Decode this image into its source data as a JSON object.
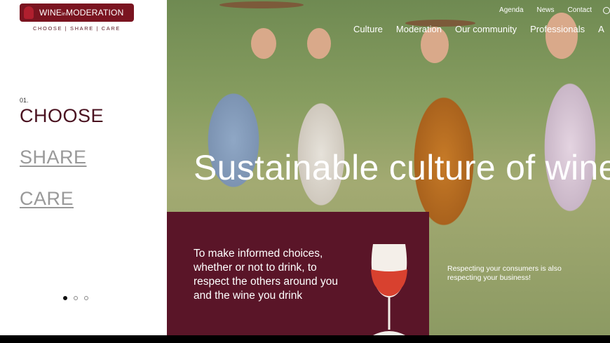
{
  "brand": {
    "logo_main": "WINE",
    "logo_small": "in",
    "logo_end": "MODERATION",
    "tagline": "CHOOSE | SHARE | CARE"
  },
  "steps": {
    "number": "01.",
    "items": [
      "CHOOSE",
      "SHARE",
      "CARE"
    ],
    "active_index": 0
  },
  "carousel": {
    "dots": 3,
    "active_index": 0
  },
  "nav": {
    "top": [
      "Agenda",
      "News",
      "Contact"
    ],
    "main": [
      "Culture",
      "Moderation",
      "Our community",
      "Professionals",
      "A"
    ]
  },
  "hero": {
    "headline": "Sustainable culture of wine",
    "card_text": "To make informed choices, whether or not to drink, to respect the others around you and the wine you drink",
    "caption": "Respecting your consumers is also respecting your business!"
  },
  "icons": {
    "search": "search-icon",
    "glass": "wine-glass-icon"
  },
  "colors": {
    "brand": "#7a1420",
    "card": "#5a1528",
    "wine": "#d8412f"
  }
}
